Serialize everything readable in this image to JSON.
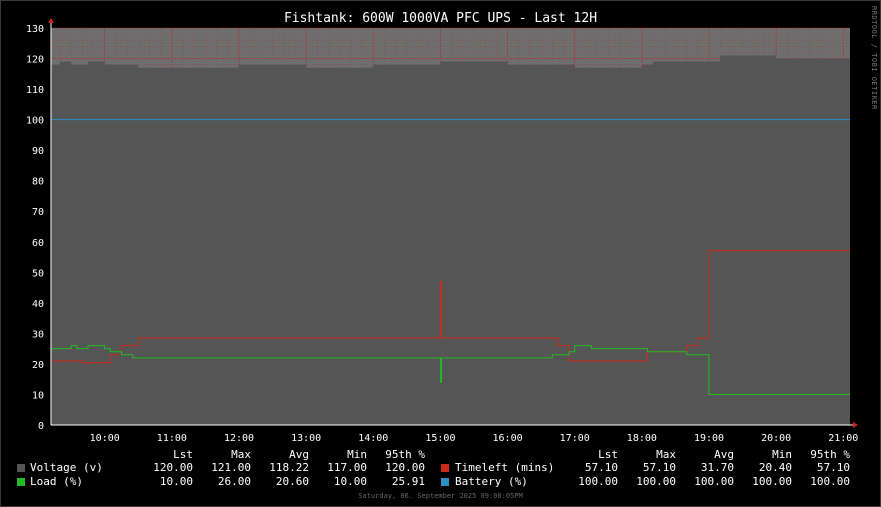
{
  "title": "Fishtank: 600W 1000VA PFC UPS - Last 12H",
  "vertical_label": "RRDTOOL / TOBI OETIKER",
  "timestamp": "Saturday, 06. September 2025 09:00:05PM",
  "colors": {
    "voltage": "#555555",
    "load": "#22bb22",
    "timeleft": "#cc2a1a",
    "battery": "#2a8fc8",
    "plot_bg": "#6e6e6e",
    "grid": "#b03030",
    "axis_text": "#ffffff"
  },
  "legend": {
    "headers": [
      "Lst",
      "Max",
      "Avg",
      "Min",
      "95th %"
    ],
    "left": [
      {
        "name": "Voltage (v)",
        "color": "#555555",
        "values": [
          "120.00",
          "121.00",
          "118.22",
          "117.00",
          "120.00"
        ]
      },
      {
        "name": "Load (%)",
        "color": "#22bb22",
        "values": [
          "10.00",
          "26.00",
          "20.60",
          "10.00",
          "25.91"
        ]
      }
    ],
    "right": [
      {
        "name": "Timeleft (mins)",
        "color": "#cc2a1a",
        "values": [
          "57.10",
          "57.10",
          "31.70",
          "20.40",
          "57.10"
        ]
      },
      {
        "name": "Battery (%)",
        "color": "#2a8fc8",
        "values": [
          "100.00",
          "100.00",
          "100.00",
          "100.00",
          "100.00"
        ]
      }
    ]
  },
  "chart_data": {
    "type": "area",
    "title": "Fishtank: 600W 1000VA PFC UPS - Last 12H",
    "ylim": [
      0,
      130
    ],
    "yticks": [
      0,
      10,
      20,
      30,
      40,
      50,
      60,
      70,
      80,
      90,
      100,
      110,
      120,
      130
    ],
    "xlim": [
      "09:12",
      "21:06"
    ],
    "xticks": [
      "10:00",
      "11:00",
      "12:00",
      "13:00",
      "14:00",
      "15:00",
      "16:00",
      "17:00",
      "18:00",
      "19:00",
      "20:00",
      "21:00"
    ],
    "grid": true,
    "series": [
      {
        "name": "Voltage (v)",
        "style": "area",
        "x": [
          "09:12",
          "09:20",
          "09:30",
          "09:45",
          "10:00",
          "10:30",
          "11:00",
          "12:00",
          "13:00",
          "14:00",
          "15:00",
          "16:00",
          "17:00",
          "18:00",
          "18:10",
          "19:00",
          "19:10",
          "20:00",
          "20:30",
          "21:06"
        ],
        "y": [
          118,
          119,
          118,
          119,
          118,
          117,
          117,
          118,
          117,
          118,
          119,
          118,
          117,
          118,
          119,
          119,
          121,
          120,
          120,
          120
        ]
      },
      {
        "name": "Battery (%)",
        "style": "line",
        "x": [
          "09:12",
          "21:06"
        ],
        "y": [
          100,
          100
        ]
      },
      {
        "name": "Timeleft (mins)",
        "style": "step",
        "x": [
          "09:12",
          "09:40",
          "10:05",
          "10:15",
          "10:30",
          "14:59",
          "15:00",
          "15:01",
          "16:35",
          "16:45",
          "16:55",
          "18:05",
          "18:35",
          "18:40",
          "18:50",
          "19:00",
          "21:06"
        ],
        "y": [
          21.0,
          20.4,
          23.0,
          26.0,
          28.5,
          28.5,
          47.0,
          28.5,
          28.5,
          26.0,
          21.0,
          24.0,
          24.0,
          26.0,
          28.5,
          57.1,
          57.1
        ]
      },
      {
        "name": "Load (%)",
        "style": "step",
        "x": [
          "09:12",
          "09:30",
          "09:35",
          "09:45",
          "10:00",
          "10:05",
          "10:15",
          "10:25",
          "14:59",
          "15:00",
          "15:01",
          "16:35",
          "16:40",
          "16:55",
          "17:00",
          "17:15",
          "17:30",
          "18:05",
          "18:35",
          "18:40",
          "19:00",
          "21:06"
        ],
        "y": [
          25,
          26,
          25,
          26,
          25,
          24,
          23,
          22,
          22,
          14,
          22,
          22,
          23,
          24,
          26,
          25,
          25,
          24,
          24,
          23,
          10,
          10
        ]
      }
    ]
  }
}
